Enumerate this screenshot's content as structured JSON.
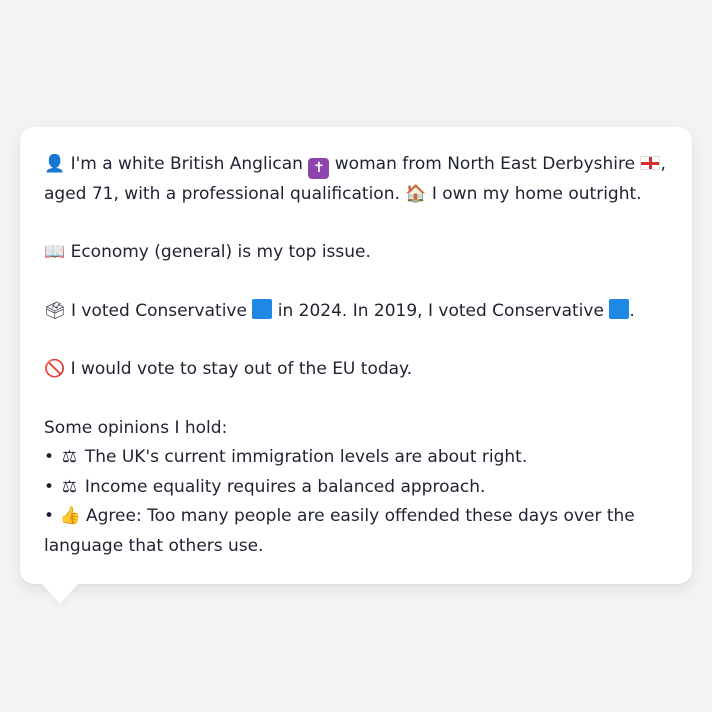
{
  "intro": {
    "person_icon": "👤",
    "text_1": "I'm a white British Anglican",
    "cross_icon": "✝",
    "text_2": "woman from North East Derbyshire",
    "text_3": ", aged 71, with a professional qualification.",
    "home_icon": "🏠",
    "text_4": "I own my home outright."
  },
  "issue": {
    "icon": "📖",
    "text": "Economy (general) is my top issue."
  },
  "vote": {
    "icon": "🗳",
    "text_1": "I voted Conservative",
    "text_2": "in 2024. In 2019, I voted Conservative",
    "text_3": ".",
    "party_color": "#1e88e5"
  },
  "eu": {
    "icon": "🚫",
    "text": "I would vote to stay out of the EU today."
  },
  "opinions": {
    "heading": "Some opinions I hold:",
    "items": [
      {
        "bullet": "•",
        "icon": "⚖",
        "text": "The UK's current immigration levels are about right."
      },
      {
        "bullet": "•",
        "icon": "⚖",
        "text": "Income equality requires a balanced approach."
      },
      {
        "bullet": "•",
        "icon": "👍",
        "text": "Agree: Too many people are easily offended these days over the language that others use."
      }
    ]
  }
}
